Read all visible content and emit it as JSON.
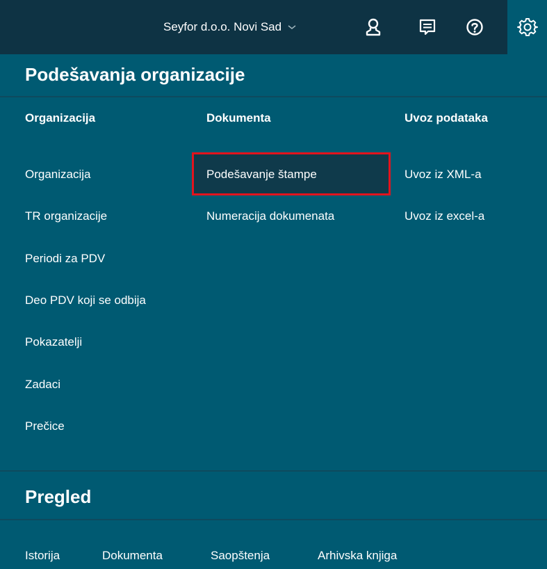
{
  "topbar": {
    "organization": "Seyfor d.o.o. Novi Sad",
    "icons": [
      "user-icon",
      "messages-icon",
      "help-icon",
      "settings-icon"
    ]
  },
  "settings": {
    "title": "Podešavanja organizacije",
    "columns": [
      {
        "heading": "Organizacija",
        "items": [
          "Organizacija",
          "TR organizacije",
          "Periodi za PDV",
          "Deo PDV koji se odbija",
          "Pokazatelji",
          "Zadaci",
          "Prečice"
        ]
      },
      {
        "heading": "Dokumenta",
        "items": [
          "Podešavanje štampe",
          "Numeracija dokumenata"
        ]
      },
      {
        "heading": "Uvoz podataka",
        "items": [
          "Uvoz iz XML-a",
          "Uvoz iz excel-a"
        ]
      }
    ]
  },
  "pregled": {
    "title": "Pregled",
    "items": [
      "Istorija",
      "Dokumenta",
      "Saopštenja",
      "Arhivska knjiga"
    ]
  },
  "colors": {
    "topbar": "#0e3344",
    "panel": "#005a72",
    "highlight_border": "#e3131d"
  }
}
